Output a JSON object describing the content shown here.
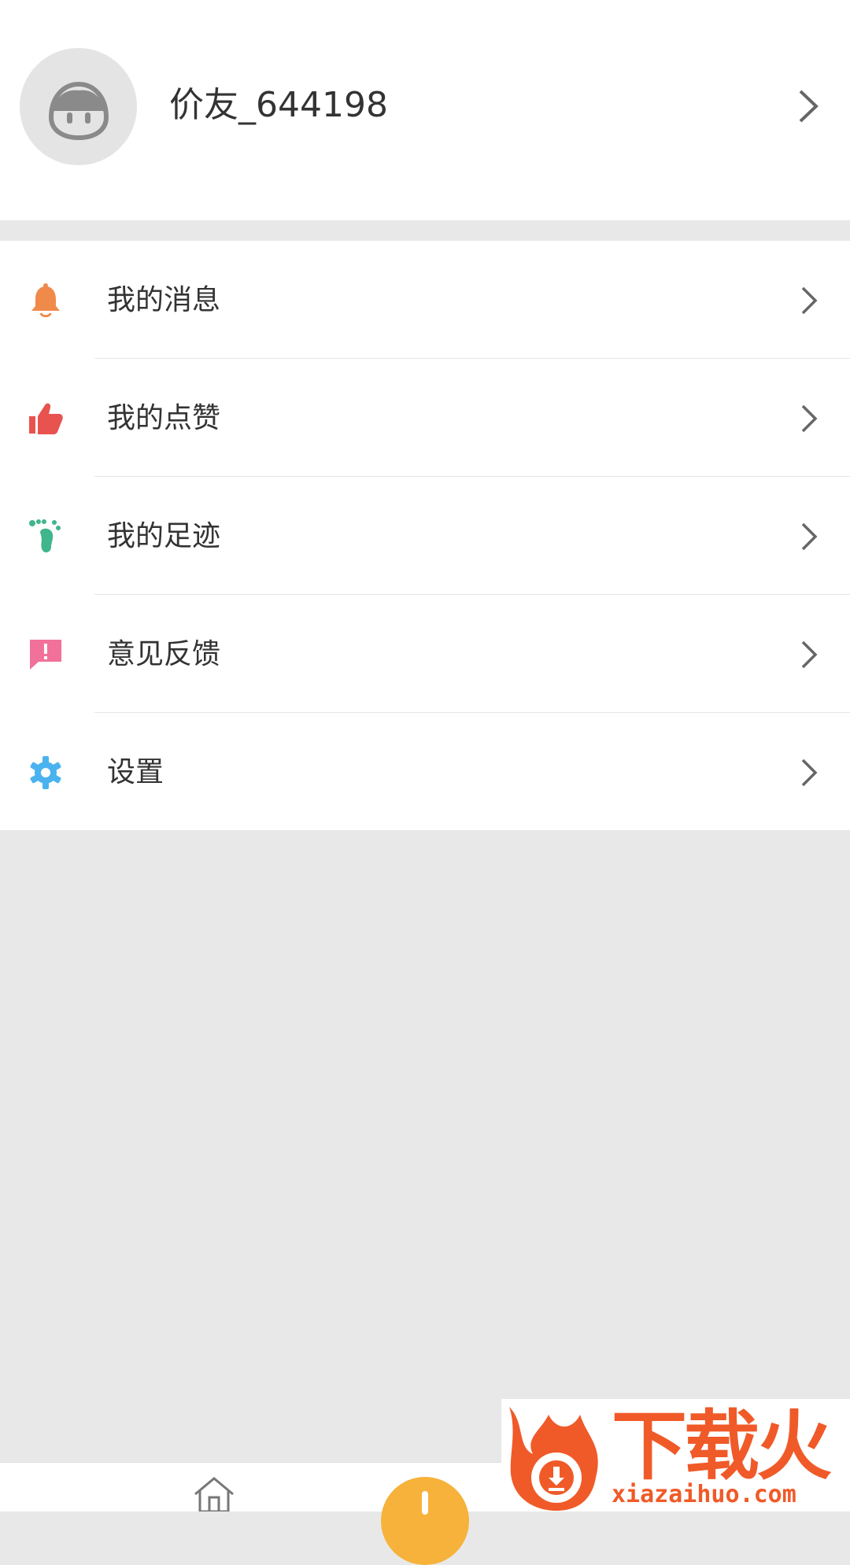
{
  "profile": {
    "username": "价友_644198"
  },
  "menu": {
    "items": [
      {
        "label": "我的消息",
        "icon": "bell-icon",
        "color": "#f08a4b"
      },
      {
        "label": "我的点赞",
        "icon": "thumbs-up-icon",
        "color": "#e8534f"
      },
      {
        "label": "我的足迹",
        "icon": "footprint-icon",
        "color": "#3fb68b"
      },
      {
        "label": "意见反馈",
        "icon": "feedback-icon",
        "color": "#f1719b"
      },
      {
        "label": "设置",
        "icon": "gear-icon",
        "color": "#4ab3ef"
      }
    ]
  },
  "tabbar": {
    "home_icon": "home-icon",
    "center_color": "#f6b23a"
  },
  "watermark": {
    "cn": "下载火",
    "en": "xiazaihuo.com"
  },
  "colors": {
    "background": "#e8e8e8",
    "text": "#333333",
    "arrow": "#666666"
  }
}
